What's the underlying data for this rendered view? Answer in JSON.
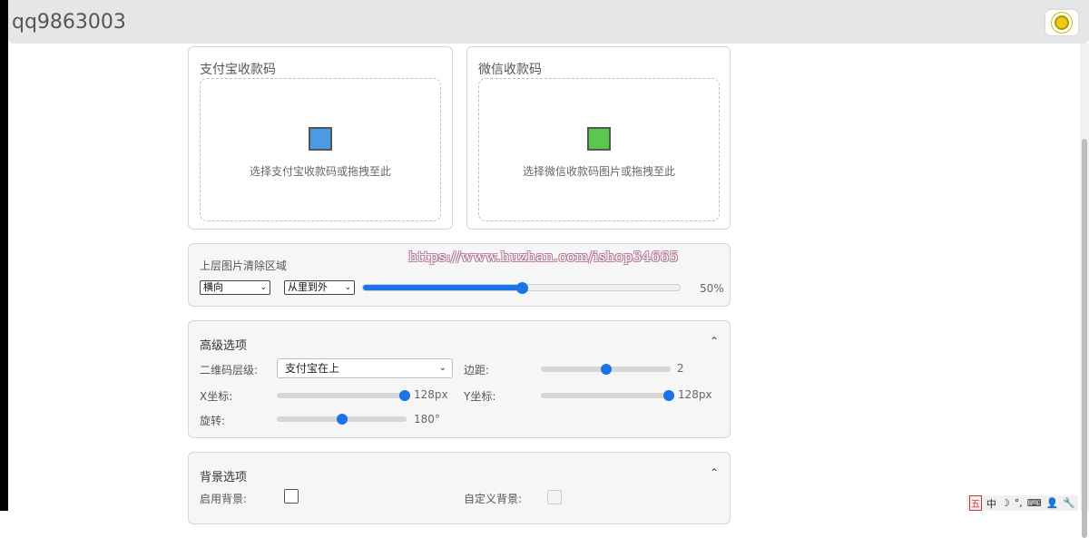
{
  "header": {
    "title": "qq9863003",
    "theme_icon": "sun-icon"
  },
  "alipay": {
    "title": "支付宝收款码",
    "drop_text": "选择支付宝收款码或拖拽至此",
    "color": "#4a9be3"
  },
  "wechat": {
    "title": "微信收款码",
    "drop_text": "选择微信收款码图片或拖拽至此",
    "color": "#5ac84f"
  },
  "clear_area": {
    "label": "上层图片清除区域",
    "direction_value": "横向",
    "order_value": "从里到外",
    "percent_text": "50%",
    "percent": 0.5
  },
  "watermark": "https://www.huzhan.com/ishop34665",
  "advanced": {
    "title": "高级选项",
    "layer_label": "二维码层级:",
    "layer_value": "支付宝在上",
    "margin_label": "边距:",
    "margin_value": "2",
    "margin_fraction": 0.5,
    "x_label": "X坐标:",
    "x_value": "128px",
    "x_fraction": 1.0,
    "y_label": "Y坐标:",
    "y_value": "128px",
    "y_fraction": 1.0,
    "rotate_label": "旋转:",
    "rotate_value": "180°",
    "rotate_fraction": 0.5
  },
  "background": {
    "title": "背景选项",
    "enable_label": "启用背景:",
    "custom_label": "自定义背景:"
  },
  "tray": {
    "items": [
      "五",
      "中",
      "☽",
      "°,",
      "⌨",
      "👤",
      "🔧"
    ]
  },
  "colors": {
    "accent": "#1a73e8"
  }
}
